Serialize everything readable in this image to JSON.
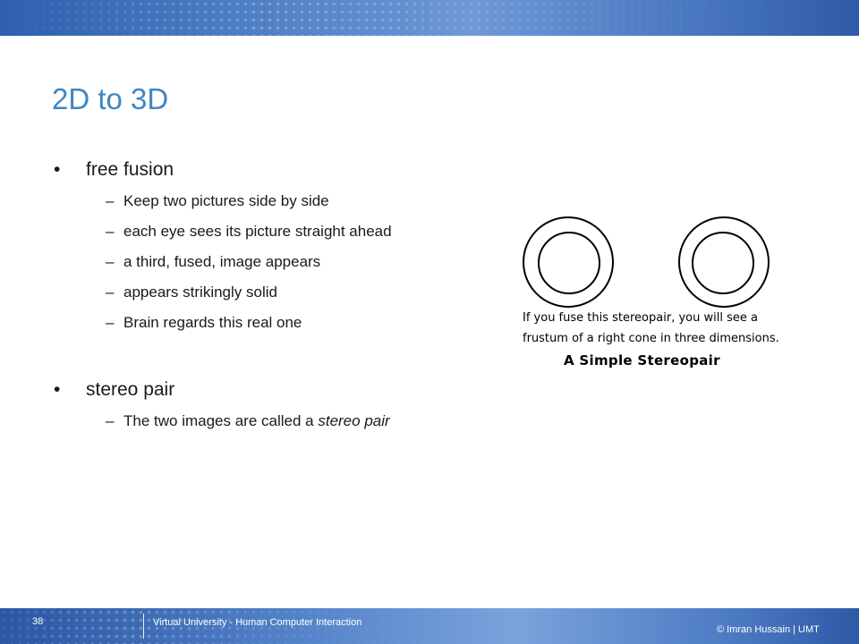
{
  "slide": {
    "title": "2D to 3D",
    "bullets": [
      {
        "text": "free fusion",
        "subitems": [
          "Keep two pictures side by side",
          "each eye sees its picture straight ahead",
          "a third, fused, image appears",
          "appears strikingly solid",
          "Brain regards this real one"
        ]
      },
      {
        "text": "stereo pair",
        "subitem_prefix": "The two images are called a ",
        "subitem_emphasis": "stereo pair"
      }
    ],
    "bullet_glyph": "•",
    "dash_glyph": "–"
  },
  "figure": {
    "caption_line1": "If you fuse this stereopair,  you will see a",
    "caption_line2": "frustum of a right cone in three dimensions.",
    "caption_title": "A Simple Stereopair"
  },
  "footer": {
    "page_number": "38",
    "course": "Virtual University - Human Computer Interaction",
    "credit": "© Imran  Hussain | UMT"
  },
  "colors": {
    "title": "#3e86c5",
    "band": "#4f7fc4",
    "text": "#1a1a1a"
  }
}
